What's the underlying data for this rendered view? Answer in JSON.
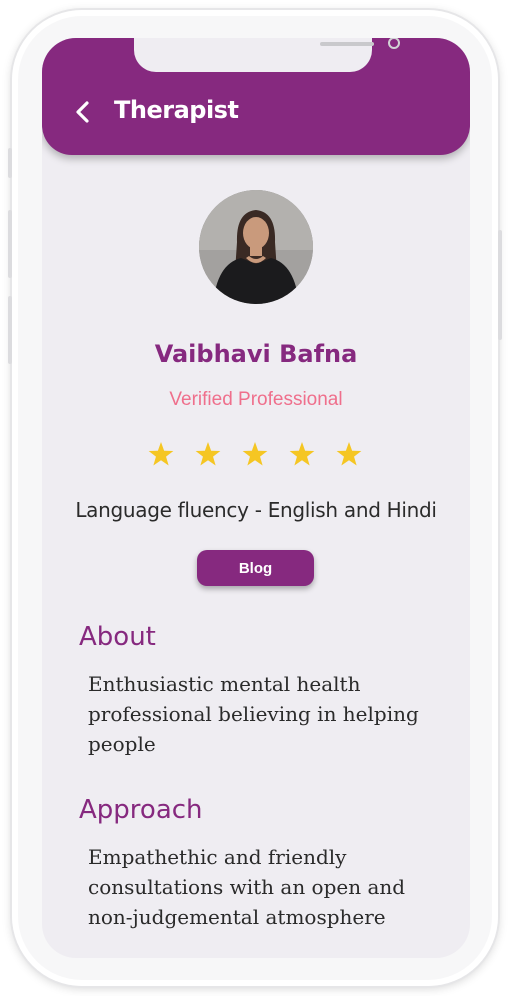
{
  "header": {
    "title": "Therapist",
    "back_icon": "chevron-left-icon"
  },
  "profile": {
    "name": "Vaibhavi Bafna",
    "status": "Verified Professional",
    "rating": 5,
    "rating_max": 5,
    "language": "Language fluency - English and Hindi",
    "blog_label": "Blog"
  },
  "about": {
    "heading": "About",
    "text": "Enthusiastic mental health professional believing in helping people"
  },
  "approach": {
    "heading": "Approach",
    "text": "Empathethic and friendly consultations with an open and non-judgemental atmosphere"
  },
  "colors": {
    "brand": "#86297f",
    "accent_pink": "#ef6f8c",
    "star": "#f5c623",
    "background": "#efedf2"
  }
}
